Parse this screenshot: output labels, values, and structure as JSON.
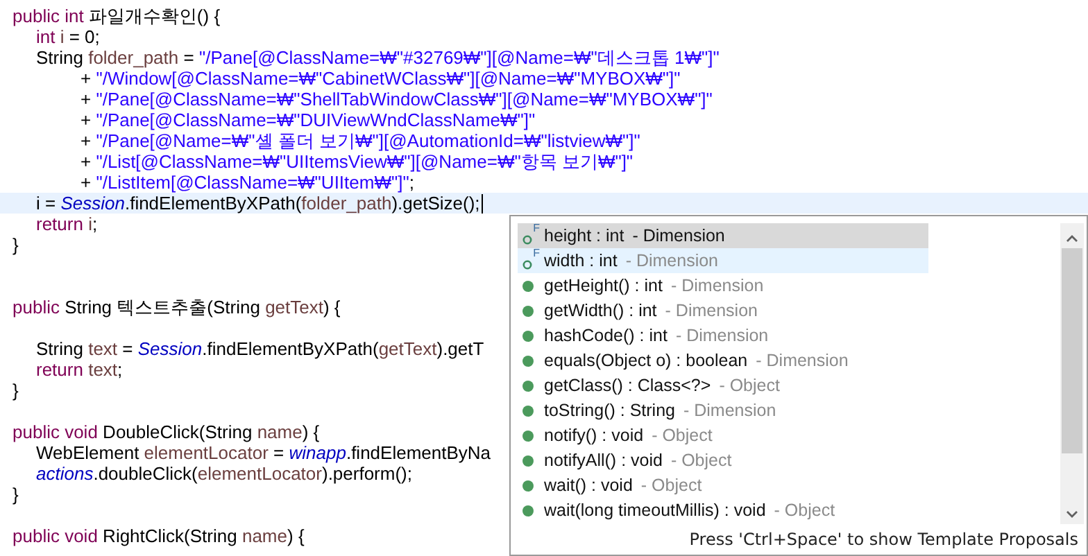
{
  "editor": {
    "blocks": [
      {
        "kind": "method",
        "header": [
          {
            "t": "public int",
            "kind": "keyword"
          },
          {
            "t": " 파일개수확인() {",
            "kind": "plain"
          }
        ],
        "lines": [
          {
            "kind": "code",
            "current": false,
            "tokens": [
              {
                "t": "int",
                "kind": "keyword"
              },
              {
                "t": " i",
                "kind": "variable"
              },
              {
                "t": " = 0;",
                "kind": "plain"
              }
            ]
          },
          {
            "kind": "code",
            "current": false,
            "tokens": [
              {
                "t": "String ",
                "kind": "plain"
              },
              {
                "t": "folder_path",
                "kind": "variable"
              },
              {
                "t": " = ",
                "kind": "plain"
              },
              {
                "t": "\"/Pane[@ClassName=₩\"#32769₩\"][@Name=₩\"데스크톱 1₩\"]\"",
                "kind": "string"
              }
            ],
            "children": [
              {
                "tokens": [
                  {
                    "t": "+ ",
                    "kind": "plain"
                  },
                  {
                    "t": "\"/Window[@ClassName=₩\"CabinetWClass₩\"][@Name=₩\"MYBOX₩\"]\"",
                    "kind": "string"
                  }
                ]
              },
              {
                "tokens": [
                  {
                    "t": "+ ",
                    "kind": "plain"
                  },
                  {
                    "t": "\"/Pane[@ClassName=₩\"ShellTabWindowClass₩\"][@Name=₩\"MYBOX₩\"]\"",
                    "kind": "string"
                  }
                ]
              },
              {
                "tokens": [
                  {
                    "t": "+ ",
                    "kind": "plain"
                  },
                  {
                    "t": "\"/Pane[@ClassName=₩\"DUIViewWndClassName₩\"]\"",
                    "kind": "string"
                  }
                ]
              },
              {
                "tokens": [
                  {
                    "t": "+ ",
                    "kind": "plain"
                  },
                  {
                    "t": "\"/Pane[@Name=₩\"셸 폴더 보기₩\"][@AutomationId=₩\"listview₩\"]\"",
                    "kind": "string"
                  }
                ]
              },
              {
                "tokens": [
                  {
                    "t": "+ ",
                    "kind": "plain"
                  },
                  {
                    "t": "\"/List[@ClassName=₩\"UIItemsView₩\"][@Name=₩\"항목 보기₩\"]\"",
                    "kind": "string"
                  }
                ]
              },
              {
                "tokens": [
                  {
                    "t": "+ ",
                    "kind": "plain"
                  },
                  {
                    "t": "\"/ListItem[@ClassName=₩\"UIItem₩\"]\"",
                    "kind": "string"
                  },
                  {
                    "t": ";",
                    "kind": "plain"
                  }
                ]
              }
            ]
          },
          {
            "kind": "code",
            "current": true,
            "tokens": [
              {
                "t": "i = ",
                "kind": "plain"
              },
              {
                "t": "Session",
                "kind": "static"
              },
              {
                "t": ".findElementByXPath(",
                "kind": "plain"
              },
              {
                "t": "folder_path",
                "kind": "variable"
              },
              {
                "t": ").getSize();",
                "kind": "plain"
              }
            ]
          },
          {
            "kind": "code",
            "current": false,
            "tokens": [
              {
                "t": "return",
                "kind": "keyword"
              },
              {
                "t": " i",
                "kind": "variable"
              },
              {
                "t": ";",
                "kind": "plain"
              }
            ]
          }
        ],
        "close": "}"
      },
      {
        "kind": "blank"
      },
      {
        "kind": "blank"
      },
      {
        "kind": "method",
        "header": [
          {
            "t": "public",
            "kind": "keyword"
          },
          {
            "t": " String 텍스트추출(String ",
            "kind": "plain"
          },
          {
            "t": "getText",
            "kind": "variable"
          },
          {
            "t": ") {",
            "kind": "plain"
          }
        ],
        "lines": [
          {
            "kind": "blank"
          },
          {
            "kind": "code",
            "current": false,
            "tokens": [
              {
                "t": "String ",
                "kind": "plain"
              },
              {
                "t": "text",
                "kind": "variable"
              },
              {
                "t": " = ",
                "kind": "plain"
              },
              {
                "t": "Session",
                "kind": "static"
              },
              {
                "t": ".findElementByXPath(",
                "kind": "plain"
              },
              {
                "t": "getText",
                "kind": "variable"
              },
              {
                "t": ").getT",
                "kind": "plain"
              }
            ]
          },
          {
            "kind": "code",
            "current": false,
            "tokens": [
              {
                "t": "return",
                "kind": "keyword"
              },
              {
                "t": " text",
                "kind": "variable"
              },
              {
                "t": ";",
                "kind": "plain"
              }
            ]
          }
        ],
        "close": "}"
      },
      {
        "kind": "blank"
      },
      {
        "kind": "method",
        "header": [
          {
            "t": "public void",
            "kind": "keyword"
          },
          {
            "t": " DoubleClick(String ",
            "kind": "plain"
          },
          {
            "t": "name",
            "kind": "variable"
          },
          {
            "t": ") {",
            "kind": "plain"
          }
        ],
        "lines": [
          {
            "kind": "code",
            "current": false,
            "tokens": [
              {
                "t": "WebElement ",
                "kind": "plain"
              },
              {
                "t": "elementLocator",
                "kind": "variable"
              },
              {
                "t": " = ",
                "kind": "plain"
              },
              {
                "t": "winapp",
                "kind": "static"
              },
              {
                "t": ".findElementByNa",
                "kind": "plain"
              }
            ]
          },
          {
            "kind": "code",
            "current": false,
            "tokens": [
              {
                "t": "actions",
                "kind": "static"
              },
              {
                "t": ".doubleClick(",
                "kind": "plain"
              },
              {
                "t": "elementLocator",
                "kind": "variable"
              },
              {
                "t": ").perform();",
                "kind": "plain"
              }
            ]
          }
        ],
        "close": "}"
      },
      {
        "kind": "blank"
      },
      {
        "kind": "method",
        "header": [
          {
            "t": "public void",
            "kind": "keyword"
          },
          {
            "t": " RightClick(String ",
            "kind": "plain"
          },
          {
            "t": "name",
            "kind": "variable"
          },
          {
            "t": ") {",
            "kind": "plain"
          }
        ]
      }
    ]
  },
  "completion": {
    "items": [
      {
        "kind": "field",
        "badge": "F",
        "label": "height : int",
        "source": "- Dimension",
        "selected": true,
        "hovered": false
      },
      {
        "kind": "field",
        "badge": "F",
        "label": "width : int",
        "source": "- Dimension",
        "selected": false,
        "hovered": true
      },
      {
        "kind": "method",
        "label": "getHeight() : int",
        "source": "- Dimension",
        "selected": false,
        "hovered": false
      },
      {
        "kind": "method",
        "label": "getWidth() : int",
        "source": "- Dimension",
        "selected": false,
        "hovered": false
      },
      {
        "kind": "method",
        "label": "hashCode() : int",
        "source": "- Dimension",
        "selected": false,
        "hovered": false
      },
      {
        "kind": "method",
        "label": "equals(Object o) : boolean",
        "source": "- Dimension",
        "selected": false,
        "hovered": false
      },
      {
        "kind": "method",
        "label": "getClass() : Class<?>",
        "source": "- Object",
        "selected": false,
        "hovered": false
      },
      {
        "kind": "method",
        "label": "toString() : String",
        "source": "- Dimension",
        "selected": false,
        "hovered": false
      },
      {
        "kind": "method",
        "label": "notify() : void",
        "source": "- Object",
        "selected": false,
        "hovered": false
      },
      {
        "kind": "method",
        "label": "notifyAll() : void",
        "source": "- Object",
        "selected": false,
        "hovered": false
      },
      {
        "kind": "method",
        "label": "wait() : void",
        "source": "- Object",
        "selected": false,
        "hovered": false
      },
      {
        "kind": "method",
        "label": "wait(long timeoutMillis) : void",
        "source": "- Object",
        "selected": false,
        "hovered": false
      }
    ],
    "hint": "Press 'Ctrl+Space' to show Template Proposals"
  }
}
